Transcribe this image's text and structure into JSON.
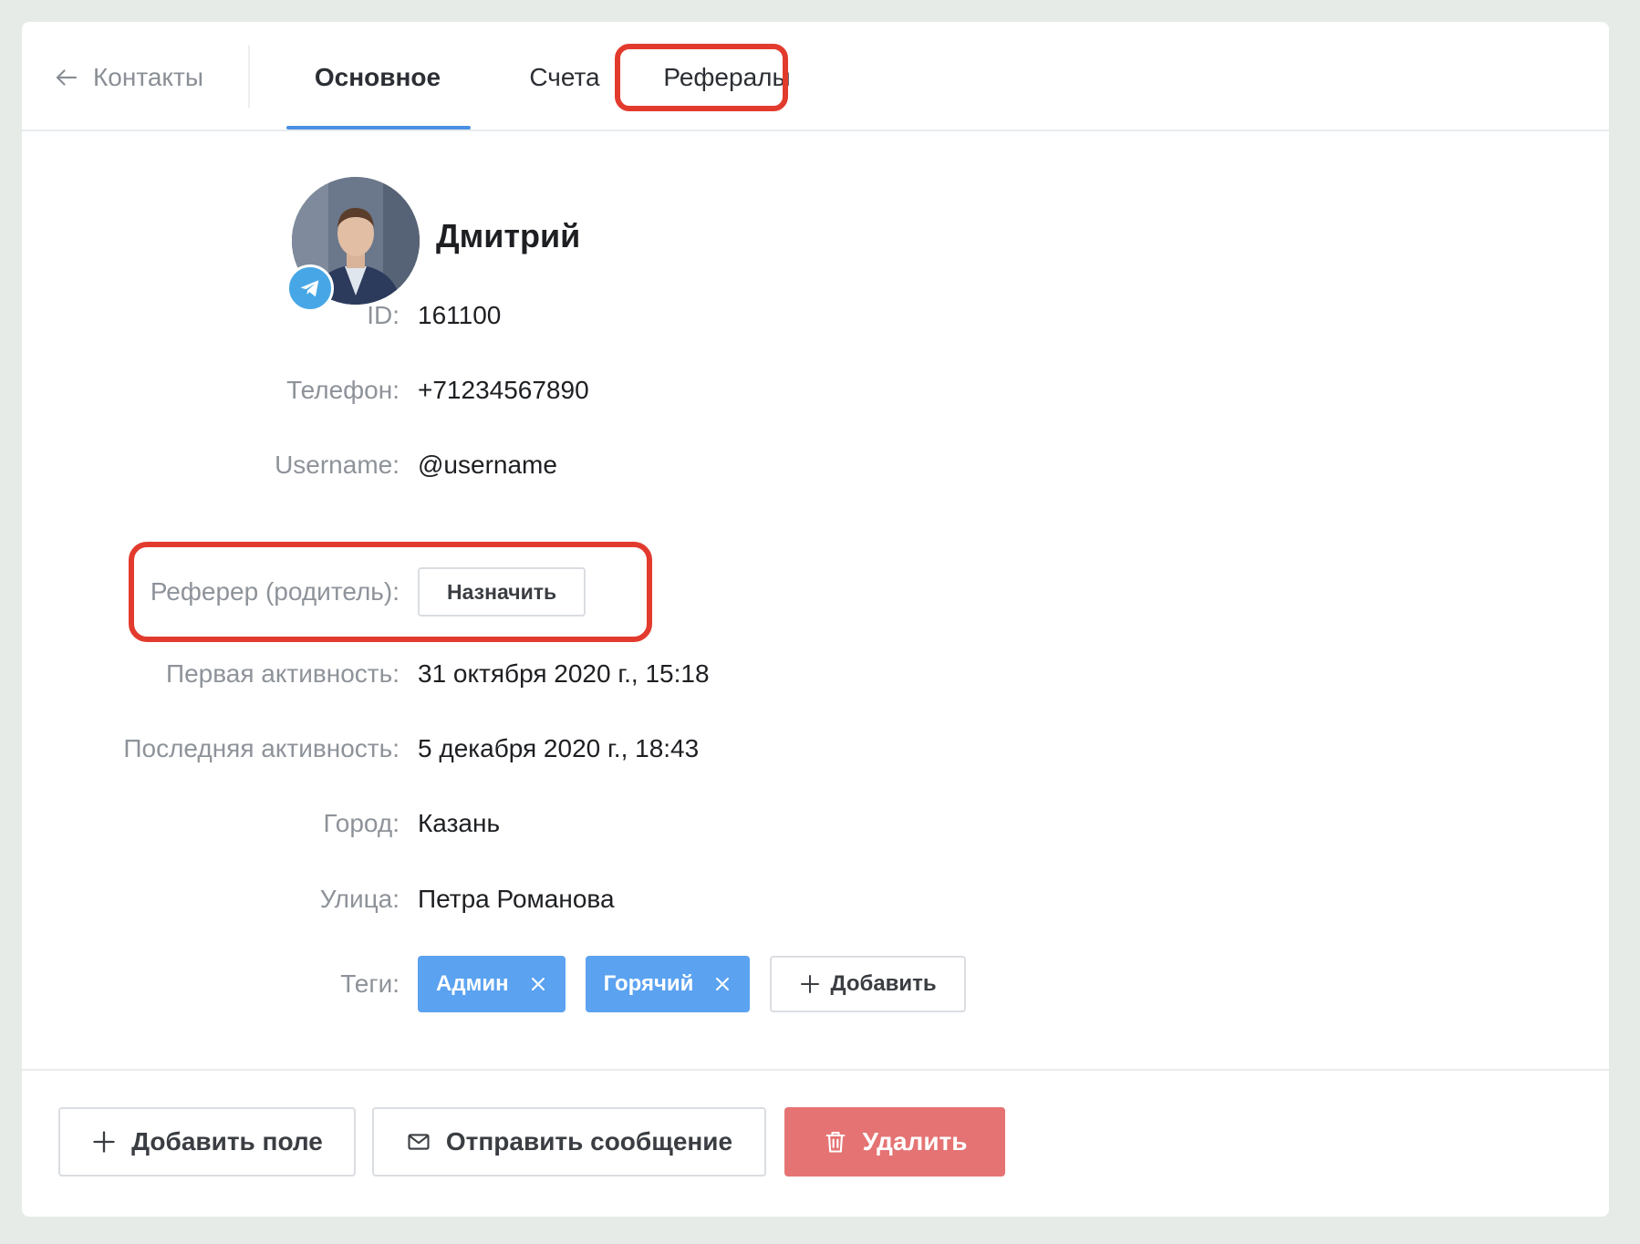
{
  "nav": {
    "back_label": "Контакты",
    "tabs": [
      {
        "label": "Основное",
        "active": true
      },
      {
        "label": "Счета",
        "active": false
      },
      {
        "label": "Рефералы",
        "active": false
      }
    ]
  },
  "contact": {
    "name": "Дмитрий",
    "messenger": "telegram-icon"
  },
  "fields": {
    "id": {
      "label": "ID:",
      "value": "161100"
    },
    "phone": {
      "label": "Телефон:",
      "value": "+71234567890"
    },
    "username": {
      "label": "Username:",
      "value": "@username"
    },
    "referrer": {
      "label": "Реферер (родитель):",
      "button_label": "Назначить"
    },
    "first_activity": {
      "label": "Первая активность:",
      "value": "31 октября 2020 г., 15:18"
    },
    "last_activity": {
      "label": "Последняя активность:",
      "value": "5 декабря 2020 г., 18:43"
    },
    "city": {
      "label": "Город:",
      "value": "Казань"
    },
    "street": {
      "label": "Улица:",
      "value": "Петра Романова"
    },
    "tags": {
      "label": "Теги:",
      "items": [
        "Админ",
        "Горячий"
      ],
      "add_label": "Добавить"
    }
  },
  "footer": {
    "add_field_label": "Добавить поле",
    "send_message_label": "Отправить сообщение",
    "delete_label": "Удалить"
  },
  "colors": {
    "accent": "#4a90e2",
    "tag": "#5ba2f0",
    "danger": "#e57373",
    "highlight": "#e23b2e"
  }
}
